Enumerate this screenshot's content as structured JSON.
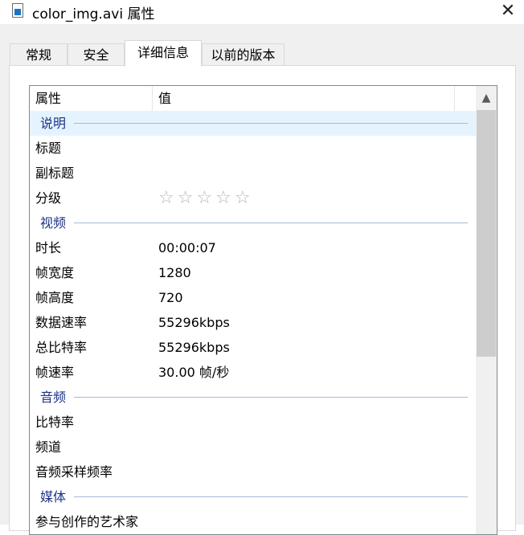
{
  "window": {
    "title": "color_img.avi 属性",
    "close_label": "✕"
  },
  "tabs": [
    {
      "label": "常规"
    },
    {
      "label": "安全"
    },
    {
      "label": "详细信息"
    },
    {
      "label": "以前的版本"
    }
  ],
  "columns": {
    "property": "属性",
    "value": "值"
  },
  "groups": {
    "description": "说明",
    "video": "视频",
    "audio": "音频",
    "media": "媒体"
  },
  "rows": {
    "title": {
      "name": "标题",
      "value": ""
    },
    "subtitle": {
      "name": "副标题",
      "value": ""
    },
    "rating": {
      "name": "分级",
      "value": "☆☆☆☆☆",
      "stars": 0
    },
    "duration": {
      "name": "时长",
      "value": "00:00:07"
    },
    "frame_width": {
      "name": "帧宽度",
      "value": "1280"
    },
    "frame_height": {
      "name": "帧高度",
      "value": "720"
    },
    "data_rate": {
      "name": "数据速率",
      "value": "55296kbps"
    },
    "total_bitrate": {
      "name": "总比特率",
      "value": "55296kbps"
    },
    "frame_rate": {
      "name": "帧速率",
      "value": "30.00 帧/秒"
    },
    "audio_bitrate": {
      "name": "比特率",
      "value": ""
    },
    "channels": {
      "name": "频道",
      "value": ""
    },
    "sample_rate": {
      "name": "音频采样频率",
      "value": ""
    },
    "contributing_artists": {
      "name": "参与创作的艺术家",
      "value": ""
    }
  },
  "scrollbar": {
    "up_arrow": "▲"
  }
}
